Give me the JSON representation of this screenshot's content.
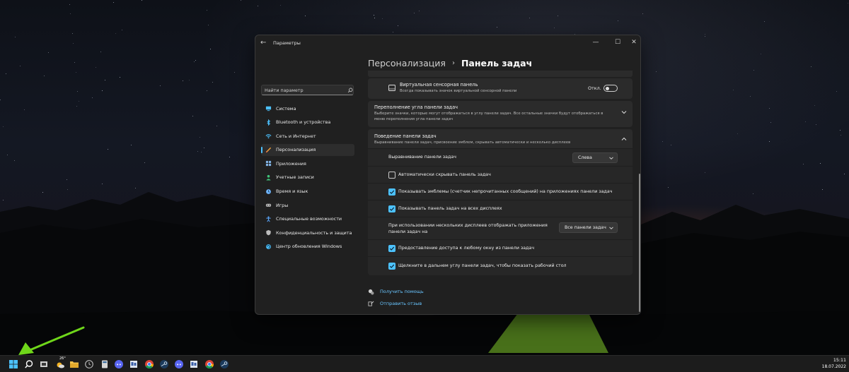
{
  "window": {
    "title": "Параметры",
    "back_glyph": "←",
    "controls": {
      "minimize": "—",
      "maximize": "☐",
      "close": "✕"
    }
  },
  "search": {
    "placeholder": "Найти параметр"
  },
  "sidebar": {
    "items": [
      {
        "label": "Система",
        "icon": "monitor-icon",
        "color": "#4cc2ff",
        "active": false
      },
      {
        "label": "Bluetooth и устройства",
        "icon": "bluetooth-icon",
        "color": "#4cc2ff",
        "active": false
      },
      {
        "label": "Сеть и Интернет",
        "icon": "wifi-icon",
        "color": "#4cc2ff",
        "active": false
      },
      {
        "label": "Персонализация",
        "icon": "brush-icon",
        "color": "#f0a03c",
        "active": true
      },
      {
        "label": "Приложения",
        "icon": "apps-icon",
        "color": "#7fb0e0",
        "active": false
      },
      {
        "label": "Учетные записи",
        "icon": "person-icon",
        "color": "#3fc47a",
        "active": false
      },
      {
        "label": "Время и язык",
        "icon": "globe-clock-icon",
        "color": "#6fb6ff",
        "active": false
      },
      {
        "label": "Игры",
        "icon": "gamepad-icon",
        "color": "#bdbdbd",
        "active": false
      },
      {
        "label": "Специальные возможности",
        "icon": "accessibility-icon",
        "color": "#5aa8ff",
        "active": false
      },
      {
        "label": "Конфиденциальность и защита",
        "icon": "shield-icon",
        "color": "#bdbdbd",
        "active": false
      },
      {
        "label": "Центр обновления Windows",
        "icon": "update-icon",
        "color": "#4cc2ff",
        "active": false
      }
    ]
  },
  "breadcrumb": {
    "parent": "Персонализация",
    "separator": "›",
    "current": "Панель задач"
  },
  "touchpad": {
    "title": "Виртуальная сенсорная панель",
    "subtitle": "Всегда показывать значок виртуальной сенсорной панели",
    "toggle_label": "Откл."
  },
  "overflow": {
    "title": "Переполнение угла панели задач",
    "subtitle": "Выберите значки, которые могут отображаться в углу панели задач. Все остальные значки будут отображаться в меню переполнения угла панели задач"
  },
  "behavior": {
    "title": "Поведение панели задач",
    "subtitle": "Выравнивание панели задач, присвоение эмблем, скрывать автоматически и несколько дисплеев",
    "alignment_label": "Выравнивание панели задач",
    "alignment_value": "Слева",
    "autohide_label": "Автоматически скрывать панель задач",
    "autohide_checked": false,
    "badges_label": "Показывать эмблемы (счетчик непрочитанных сообщений) на приложениях панели задач",
    "badges_checked": true,
    "all_displays_label": "Показывать панель задач на всех дисплеях",
    "all_displays_checked": true,
    "multi_display_label": "При использовании нескольких дисплеев отображать приложения панели задач на",
    "multi_display_value": "Все панели задач",
    "share_label": "Предоставление доступа к любому окну из панели задач",
    "share_checked": true,
    "far_corner_label": "Щелкните в дальнем углу панели задач, чтобы показать рабочий стол",
    "far_corner_checked": true
  },
  "links": {
    "help": "Получить помощь",
    "feedback": "Отправить отзыв"
  },
  "taskbar": {
    "weather_temp": "26°",
    "time": "15:11",
    "date": "18.07.2022"
  },
  "colors": {
    "accent": "#4cc2ff",
    "window_bg": "#202020",
    "card_bg": "#2b2b2b",
    "arrow": "#6fd61a"
  }
}
